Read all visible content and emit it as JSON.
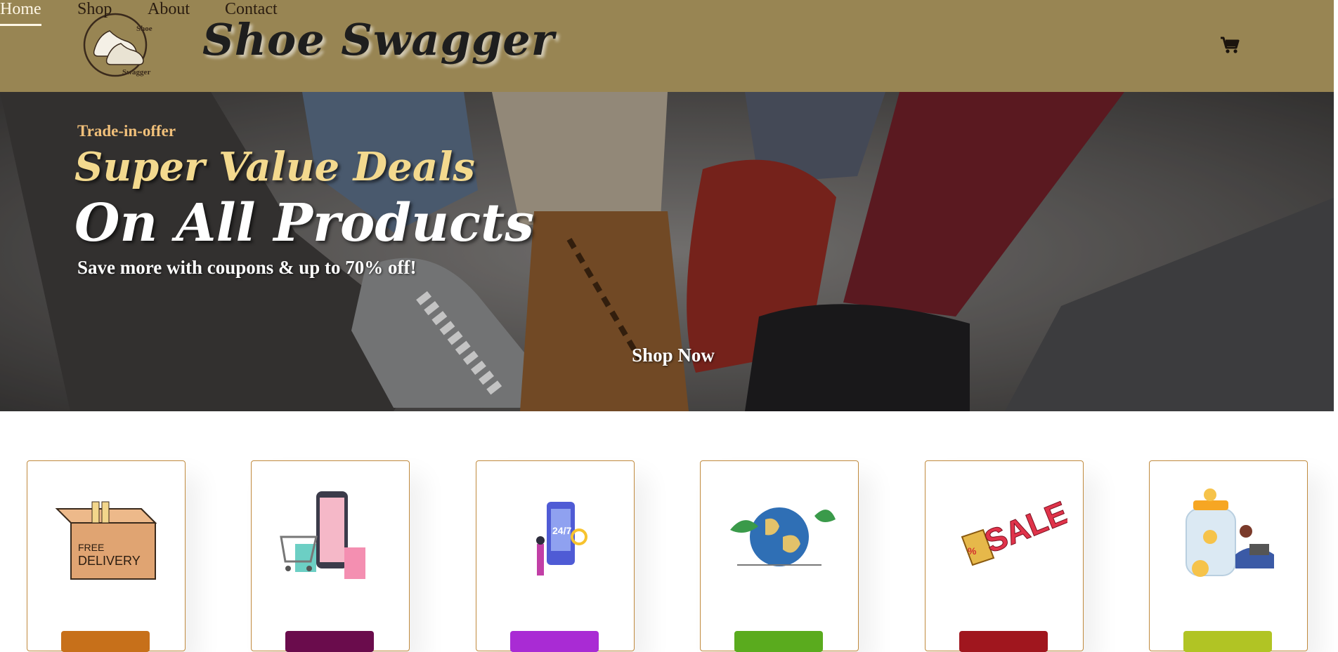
{
  "header": {
    "brand": "Shoe Swagger",
    "logo": {
      "text_top": "Shoe",
      "text_bottom": "Swagger"
    },
    "nav": [
      {
        "label": "Home",
        "active": true
      },
      {
        "label": "Shop",
        "active": false
      },
      {
        "label": "About",
        "active": false
      },
      {
        "label": "Contact",
        "active": false
      }
    ],
    "cart_icon": "shopping-cart-icon"
  },
  "hero": {
    "kicker": "Trade-in-offer",
    "headline_1": "Super Value Deals",
    "headline_2": "On All Products",
    "subtext": "Save more with coupons & up to 70% off!",
    "cta_label": "Shop Now"
  },
  "features": [
    {
      "icon": "free-delivery-box-icon",
      "label_color": "#c7701a"
    },
    {
      "icon": "online-order-phone-icon",
      "label_color": "#6a0c4c"
    },
    {
      "icon": "support-24-7-icon",
      "label_color": "#a92bd4"
    },
    {
      "icon": "global-world-icon",
      "label_color": "#5aab1e"
    },
    {
      "icon": "sale-tag-icon",
      "label_color": "#a0161e"
    },
    {
      "icon": "save-money-jar-icon",
      "label_color": "#b1c424"
    }
  ],
  "colors": {
    "header_bg": "#988553",
    "nav_active": "#fff7e6",
    "accent_border": "#c08a3e"
  }
}
